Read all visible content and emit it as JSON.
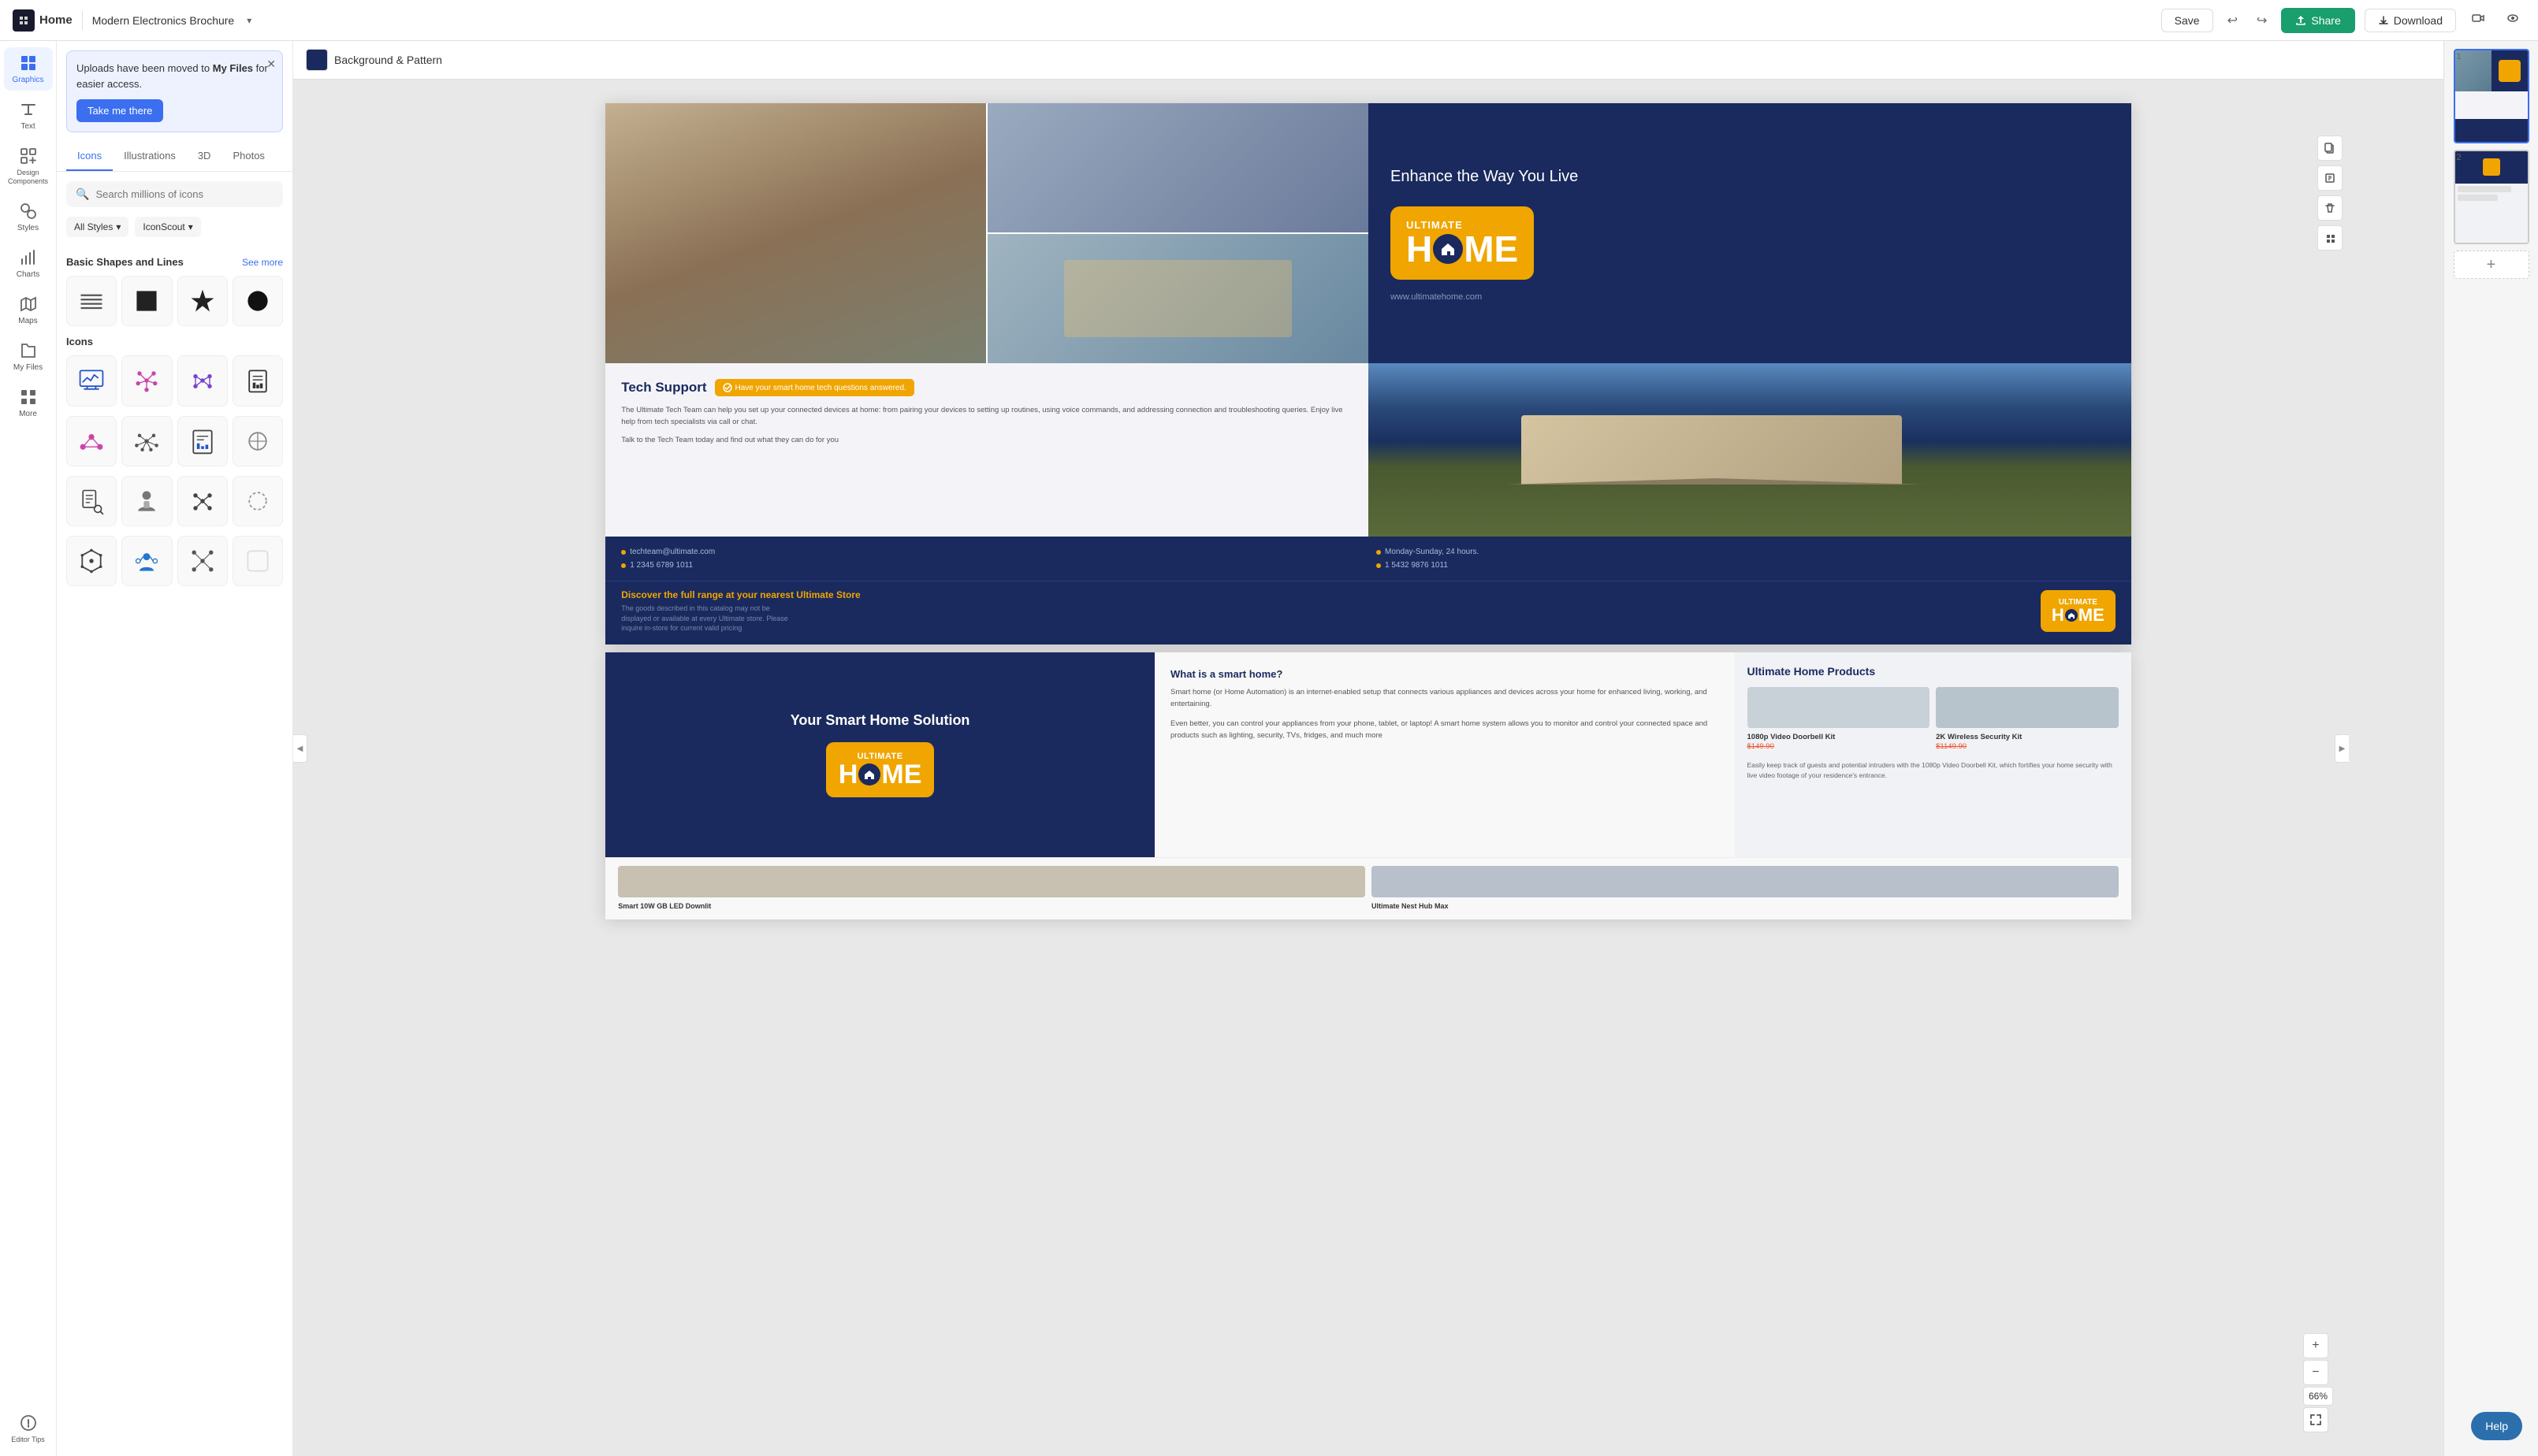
{
  "topbar": {
    "logo_icon": "K",
    "home_label": "Home",
    "document_title": "Modern Electronics Brochure",
    "save_label": "Save",
    "share_label": "Share",
    "download_label": "Download"
  },
  "canvas_header": {
    "section_label": "Background & Pattern"
  },
  "sidebar_icons": [
    {
      "id": "graphics",
      "label": "Graphics",
      "active": true
    },
    {
      "id": "text",
      "label": "Text",
      "active": false
    },
    {
      "id": "design-components",
      "label": "Design Components",
      "active": false
    },
    {
      "id": "styles",
      "label": "Styles",
      "active": false
    },
    {
      "id": "charts",
      "label": "Charts",
      "active": false
    },
    {
      "id": "maps",
      "label": "Maps",
      "active": false
    },
    {
      "id": "my-files",
      "label": "My Files",
      "active": false
    },
    {
      "id": "more",
      "label": "More",
      "active": false
    },
    {
      "id": "editor-tips",
      "label": "Editor Tips",
      "active": false
    }
  ],
  "panel": {
    "notification": {
      "text": "Uploads have been moved to ",
      "link_text": "My Files",
      "text2": " for easier access.",
      "button_label": "Take me there"
    },
    "tabs": [
      "Icons",
      "Illustrations",
      "3D",
      "Photos"
    ],
    "active_tab": "Icons",
    "search_placeholder": "Search millions of icons",
    "filters": {
      "style": "All Styles",
      "source": "IconScout"
    },
    "basic_shapes_title": "Basic Shapes and Lines",
    "see_more_label": "See more",
    "icons_title": "Icons"
  },
  "zoom": {
    "plus_label": "+",
    "minus_label": "−",
    "level": "66%",
    "fit_icon": "⤢"
  },
  "brochure": {
    "page1": {
      "tagline": "Enhance the Way You Live",
      "url": "www.ultimatehome.com",
      "logo_line1": "ULTIMATE",
      "logo_h": "H",
      "logo_me": "ME",
      "tech_title": "Tech Support",
      "tech_badge": "Have your smart home tech questions answered.",
      "tech_body1": "The Ultimate Tech Team can help you set up your connected devices at home: from pairing your devices to setting up routines, using voice commands, and addressing connection and troubleshooting queries. Enjoy live help from tech specialists via call or chat.",
      "tech_body2": "Talk to the Tech Team today and find out what they can do for you",
      "contact_email": "techteam@ultimate.com",
      "contact_hours": "Monday-Sunday, 24 hours.",
      "contact_phone1": "1 2345 6789 1011",
      "contact_phone2": "1 5432 9876 1011",
      "store_banner": "Discover the full range at your nearest Ultimate Store",
      "store_fine": "The goods described in this catalog may not be displayed or available at every Ultimate store. Please inquire in-store for current valid pricing"
    },
    "page2": {
      "solution_label": "Your Smart Home Solution",
      "what_title": "What is a smart home?",
      "what_body": "Smart home (or Home Automation) is an internet-enabled setup that connects various appliances and devices across your home for enhanced living, working, and entertaining.",
      "what_body2": "Even better, you can control your appliances from your phone, tablet, or laptop! A smart home system allows you to monitor and control your connected space and products such as lighting, security, TVs, fridges, and much more",
      "products_title": "Ultimate Home Products",
      "products": [
        {
          "name": "1080p Video Doorbell Kit",
          "price": "$149.90",
          "img_bg": "#c8d0d8"
        },
        {
          "name": "2K Wireless Security Kit",
          "price": "$1149.90",
          "img_bg": "#b8c4cc"
        },
        {
          "name": "Smart 10W GB LED Downlit",
          "price": "",
          "img_bg": "#d0c8b8"
        },
        {
          "name": "Ultimate Nest Hub Max",
          "price": "",
          "img_bg": "#c0c8d0"
        }
      ]
    }
  },
  "thumbnails": [
    {
      "number": "1",
      "active": true
    },
    {
      "number": "2",
      "active": false
    }
  ],
  "help_button": "Help"
}
